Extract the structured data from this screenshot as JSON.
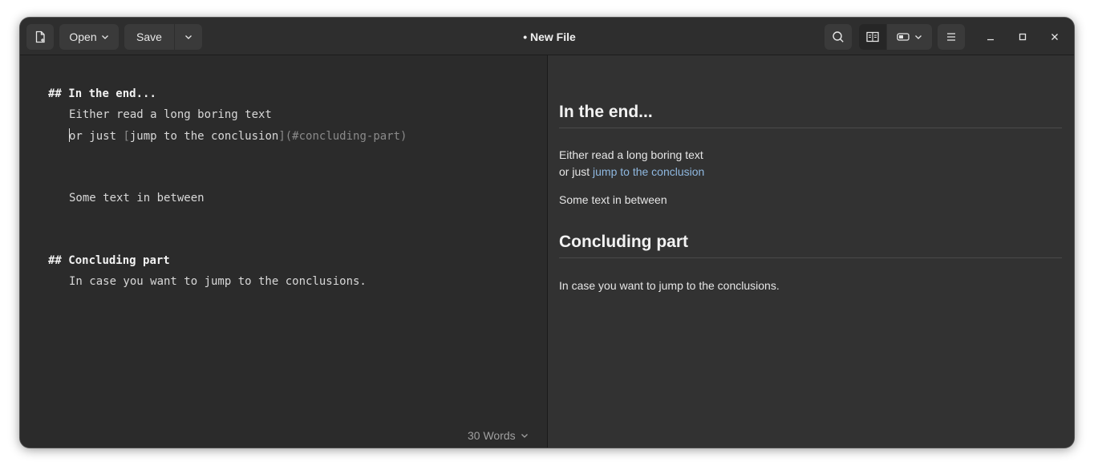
{
  "header": {
    "title": "• New File",
    "open_label": "Open",
    "save_label": "Save"
  },
  "editor": {
    "lines": [
      {
        "prefix": "## ",
        "text": "In the end..."
      },
      {
        "text": "Either read a long boring text"
      },
      {
        "pre": "or just ",
        "link_open": "[",
        "link_text": "jump to the conclusion",
        "link_close": "](#concluding-part)"
      },
      {
        "text": "Some text in between"
      },
      {
        "prefix": "## ",
        "text": "Concluding part"
      },
      {
        "text": "In case you want to jump to the conclusions."
      }
    ],
    "word_count": "30 Words"
  },
  "preview": {
    "heading1": "In the end...",
    "para1_line1": "Either read a long boring text",
    "para1_line2_pre": "or just ",
    "para1_link": "jump to the conclusion",
    "para2": "Some text in between",
    "heading2": "Concluding part",
    "para3": "In case you want to jump to the conclusions."
  },
  "colors": {
    "background": "#2b2b2b",
    "preview_background": "#323232",
    "link": "#8fb8e0"
  },
  "icons": [
    "new-file-icon",
    "chevron-down-icon",
    "search-icon",
    "split-view-icon",
    "preview-mode-icon",
    "menu-icon",
    "minimize-icon",
    "maximize-icon",
    "close-icon"
  ]
}
